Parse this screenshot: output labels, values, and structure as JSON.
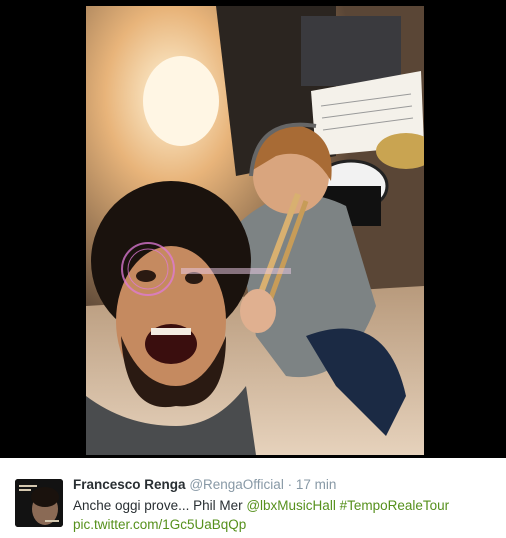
{
  "media": {
    "photo_icon": "selfie-photo",
    "watermark_icon": "watermark-seal"
  },
  "tweet": {
    "author_name": "Francesco Renga",
    "author_handle": "@RengaOfficial",
    "separator": "·",
    "timestamp": "17 min",
    "text_plain": "Anche oggi prove... Phil Mer ",
    "mention": "@lbxMusicHall",
    "hashtag": "#TempoRealeTour",
    "media_link": "pic.twitter.com/1Gc5UaBqQp",
    "avatar_icon": "album-cover-avatar"
  },
  "colors": {
    "stage_background": "#000000",
    "link_color": "#56901c",
    "name_color": "#292f33",
    "meta_color": "#8899a6"
  }
}
